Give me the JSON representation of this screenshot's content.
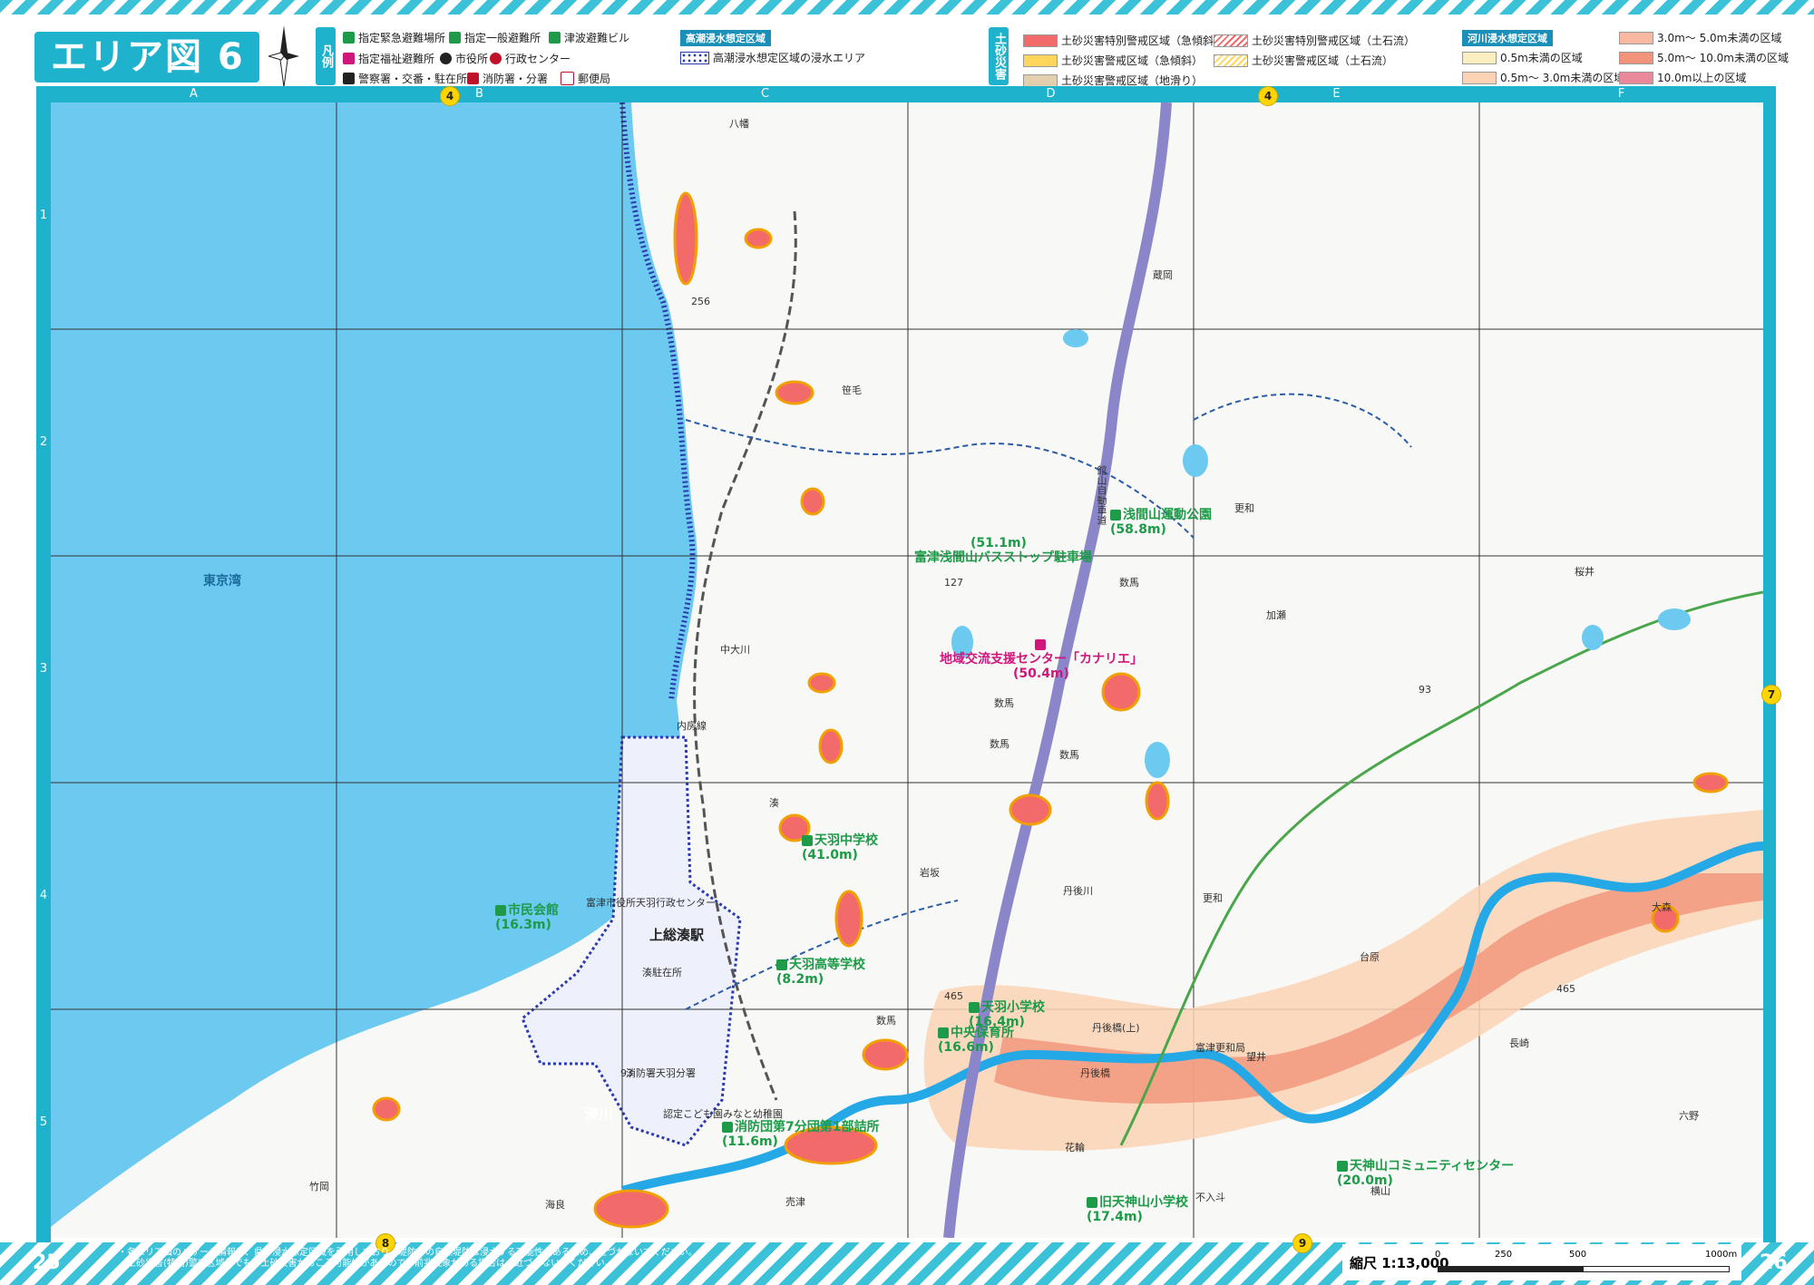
{
  "title": "エリア図 6",
  "compass_label": "N",
  "legend": {
    "tag": "凡例",
    "items": [
      {
        "label": "指定緊急避難場所",
        "icon": "evacuation-site-icon",
        "color": "#1d9b48"
      },
      {
        "label": "指定一般避難所",
        "icon": "general-shelter-icon",
        "color": "#1d9b48"
      },
      {
        "label": "津波避難ビル",
        "icon": "tsunami-building-icon",
        "color": "#1d9b48"
      },
      {
        "label": "指定福祉避難所",
        "icon": "welfare-shelter-icon",
        "color": "#d0167a"
      },
      {
        "label": "市役所",
        "icon": "city-hall-icon",
        "color": "#222"
      },
      {
        "label": "行政センター",
        "icon": "admin-center-icon",
        "color": "#c0102a"
      },
      {
        "label": "警察署・交番・駐在所",
        "icon": "police-icon",
        "color": "#222"
      },
      {
        "label": "消防署・分署",
        "icon": "fire-station-icon",
        "color": "#c0102a"
      },
      {
        "label": "郵便局",
        "icon": "post-office-icon",
        "color": "#c0102a"
      }
    ]
  },
  "storm_surge": {
    "head": "高潮浸水想定区域",
    "label": "高潮浸水想定区域の浸水エリア"
  },
  "sediment": {
    "tag": "土砂災害",
    "items": [
      {
        "label": "土砂災害特別警戒区域（急傾斜）",
        "color": "#f26a6a"
      },
      {
        "label": "土砂災害特別警戒区域（土石流）",
        "color": "#f26a6a"
      },
      {
        "label": "土砂災害警戒区域（急傾斜）",
        "color": "#ffd65c"
      },
      {
        "label": "土砂災害警戒区域（土石流）",
        "color": "#ffd65c"
      },
      {
        "label": "土砂災害警戒区域（地滑り）",
        "color": "#e3cfae"
      }
    ]
  },
  "river_flood": {
    "head": "河川浸水想定区域",
    "items": [
      {
        "label": "0.5m未満の区域",
        "color": "#fbefc2"
      },
      {
        "label": "0.5m〜 3.0m未満の区域",
        "color": "#fbd3b4"
      },
      {
        "label": "3.0m〜 5.0m未満の区域",
        "color": "#f8b9a0"
      },
      {
        "label": "5.0m〜 10.0m未満の区域",
        "color": "#f39379"
      },
      {
        "label": "10.0m以上の区域",
        "color": "#e9899a"
      }
    ]
  },
  "columns": [
    "A",
    "B",
    "C",
    "D",
    "E",
    "F"
  ],
  "rows": [
    "1",
    "2",
    "3",
    "4",
    "5"
  ],
  "pins": {
    "top_b": "4",
    "top_e": "4",
    "right": "7",
    "bottom_b": "8",
    "bottom_e": "9"
  },
  "places": {
    "bay": "東京湾",
    "yawata": "八幡",
    "kasamo": "笹毛",
    "sakaeoka": "蔵岡",
    "sarawa": "更和",
    "kazuma1": "数馬",
    "kazuma2": "数馬",
    "kazuma3": "数馬",
    "kazuma4": "数馬",
    "kazuma5": "数馬",
    "kase": "加瀬",
    "sakurai": "桜井",
    "iwasaka": "岩坂",
    "sarawa2": "更和",
    "takahara": "台原",
    "nagasaki": "長崎",
    "tsubone": "望井",
    "ookubo": "大森",
    "rokuno": "六野",
    "takezawa": "竹岡",
    "umira": "海良",
    "uriya": "売津",
    "hanawa": "花輪",
    "fuiri": "不入斗",
    "sakuyama": "横山",
    "minatogawa": "湊川",
    "minato": "湊",
    "futagobashi_up": "丹後橋(上)",
    "futagobashi": "丹後橋",
    "tomitsu_sarawa": "富津更和局",
    "railway": "内房線",
    "expressway": "館山自動車道",
    "route_127": "127",
    "route_465": "465",
    "route_465b": "465",
    "route_93": "93",
    "route_93b": "93",
    "route_256": "256",
    "river_small": "中大川",
    "river_tanba": "丹後川"
  },
  "facilities": {
    "sengenyama_park": {
      "name": "浅間山運動公園",
      "elev": "(58.8m)"
    },
    "bus_stop": {
      "name": "富津浅間山バスストップ駐車場",
      "elev": "(51.1m)"
    },
    "kanarie": {
      "name": "地域交流支援センター「カナリエ」",
      "elev": "(50.4m)"
    },
    "amaha_jhs": {
      "name": "天羽中学校",
      "elev": "(41.0m)"
    },
    "shimin_kaikan": {
      "name": "市民会館",
      "elev": "(16.3m)"
    },
    "amaha_hs": {
      "name": "天羽高等学校",
      "elev": "(8.2m)"
    },
    "amaha_es": {
      "name": "天羽小学校",
      "elev": "(16.4m)"
    },
    "chuo_nursery": {
      "name": "中央保育所",
      "elev": "(16.6m)"
    },
    "fire_brigade": {
      "name": "消防団第7分団第1部詰所",
      "elev": "(11.6m)"
    },
    "amakamiyama_center": {
      "name": "天神山コミュニティセンター",
      "elev": "(20.0m)"
    },
    "old_amakamiyama_es": {
      "name": "旧天神山小学校",
      "elev": "(17.4m)"
    },
    "city_admin": "富津市役所天羽行政センター",
    "kazusa_minato_station": "上総湊駅",
    "minato_kouban": "湊駐在所",
    "fire_substation": "消防署天羽分署",
    "kodomoen": "認定こども園みなと幼稚園"
  },
  "footer": {
    "page_left": "25",
    "page_right": "26",
    "note_1": "・各エリア図のハザード情報は、県の浸水想定区域を引用しており、堤防部の自然堤防は浸水する可能性があるため、近づかないでください。",
    "note_2": "・土砂災害(特別)警戒区域外でも、土砂災害がおこる可能性があるので、前兆現象がある場合は、近づかないでください。",
    "scale": "縮尺 1:13,000",
    "ticks": [
      "0",
      "250",
      "500",
      "1000m"
    ]
  },
  "colors": {
    "accent": "#1fb2cc",
    "sea": "#6ccaf0",
    "river": "#25a9e6",
    "expressway": "#8a86c9",
    "rail": "#555555",
    "sediment_red": "#f26a6a",
    "sediment_yellow": "#ffd65c"
  }
}
